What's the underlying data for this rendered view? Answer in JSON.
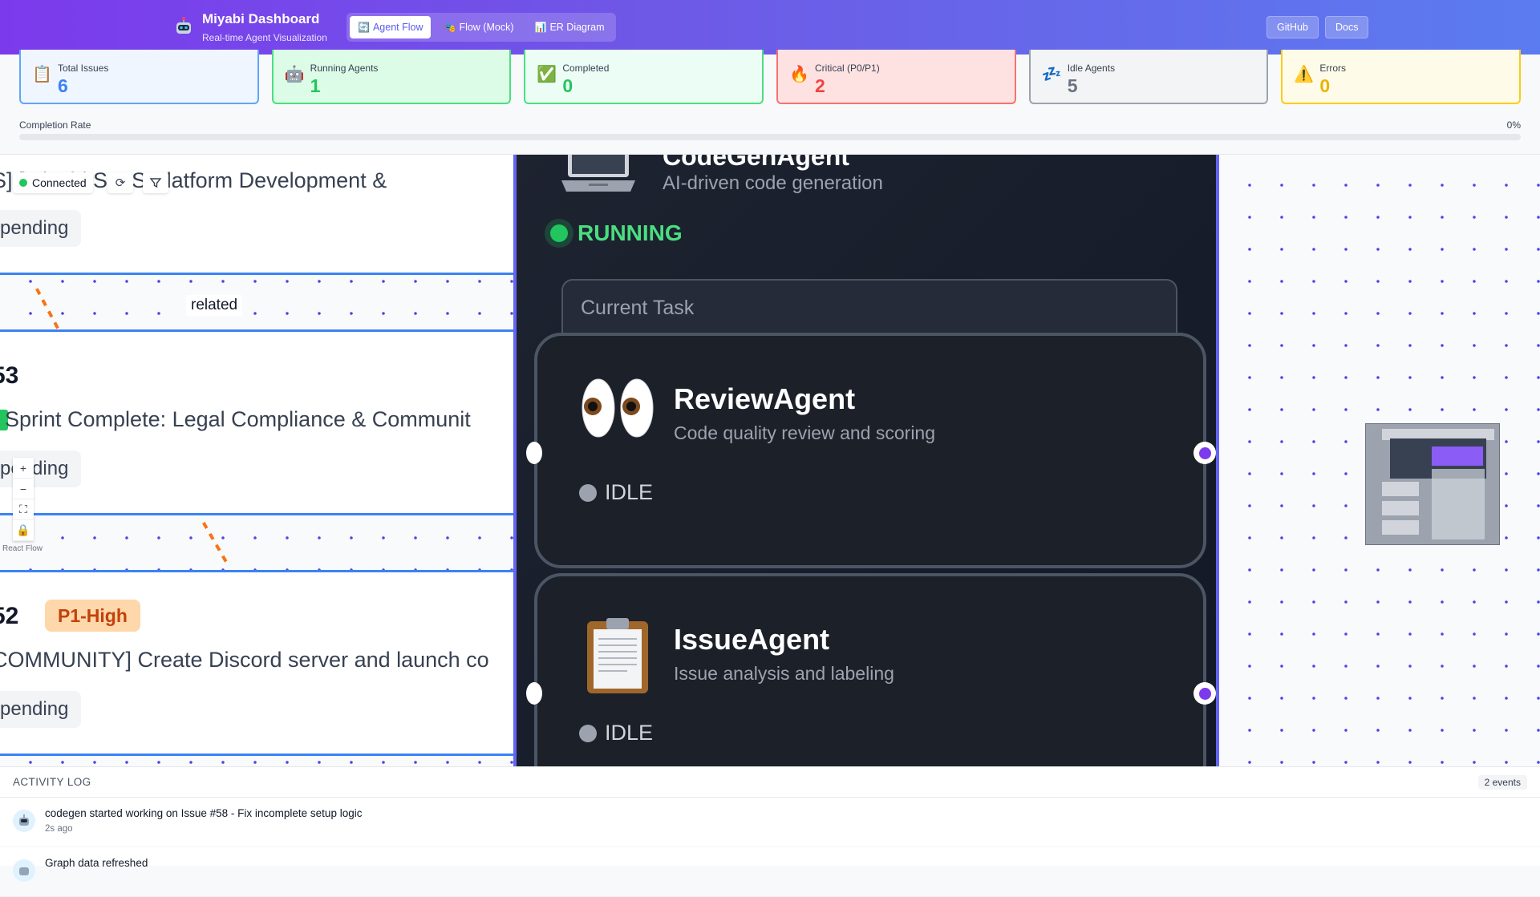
{
  "header": {
    "title": "Miyabi Dashboard",
    "subtitle": "Real-time Agent Visualization",
    "tabs": [
      {
        "icon": "🔄",
        "label": "Agent Flow"
      },
      {
        "icon": "🎭",
        "label": "Flow (Mock)"
      },
      {
        "icon": "📊",
        "label": "ER Diagram"
      }
    ],
    "github_label": "GitHub",
    "docs_label": "Docs"
  },
  "stats": [
    {
      "icon": "📋",
      "label": "Total Issues",
      "value": "6"
    },
    {
      "icon": "🤖",
      "label": "Running Agents",
      "value": "1"
    },
    {
      "icon": "✅",
      "label": "Completed",
      "value": "0"
    },
    {
      "icon": "🔥",
      "label": "Critical (P0/P1)",
      "value": "2"
    },
    {
      "icon": "💤",
      "label": "Idle Agents",
      "value": "5"
    },
    {
      "icon": "⚠️",
      "label": "Errors",
      "value": "0"
    }
  ],
  "completion": {
    "label": "Completion Rate",
    "percent_text": "0%",
    "fraction": 0
  },
  "connection": {
    "label": "Connected"
  },
  "issues": [
    {
      "title": "S] [Miyabi SaaS Platform Development &",
      "status": "pending"
    },
    {
      "number": "53",
      "title": "Sprint Complete: Legal Compliance & Communit",
      "status": "pending"
    },
    {
      "number": "52",
      "priority": "P1-High",
      "title": "COMMUNITY] Create Discord server and launch co",
      "status": "pending"
    }
  ],
  "edge_label": "related",
  "agents": {
    "top": {
      "desc": "AI-driven code generation",
      "title": "CodeGenAgent",
      "status": "RUNNING",
      "task_label": "Current Task"
    },
    "review": {
      "emoji": "👀",
      "name": "ReviewAgent",
      "desc": "Code quality review and scoring",
      "status": "IDLE"
    },
    "issue": {
      "emoji": "📋",
      "name": "IssueAgent",
      "desc": "Issue analysis and labeling",
      "status": "IDLE"
    }
  },
  "react_flow_label": "React Flow",
  "activity": {
    "title": "ACTIVITY LOG",
    "count": "2 events",
    "items": [
      {
        "message": "codegen started working on Issue #58 - Fix incomplete setup logic",
        "time": "2s ago"
      },
      {
        "message": "Graph data refreshed",
        "time": ""
      }
    ]
  },
  "colors": {
    "header_start": "#7c3aed",
    "header_end": "#5b7cf0",
    "accent": "#6366f1",
    "running": "#22c55e"
  }
}
